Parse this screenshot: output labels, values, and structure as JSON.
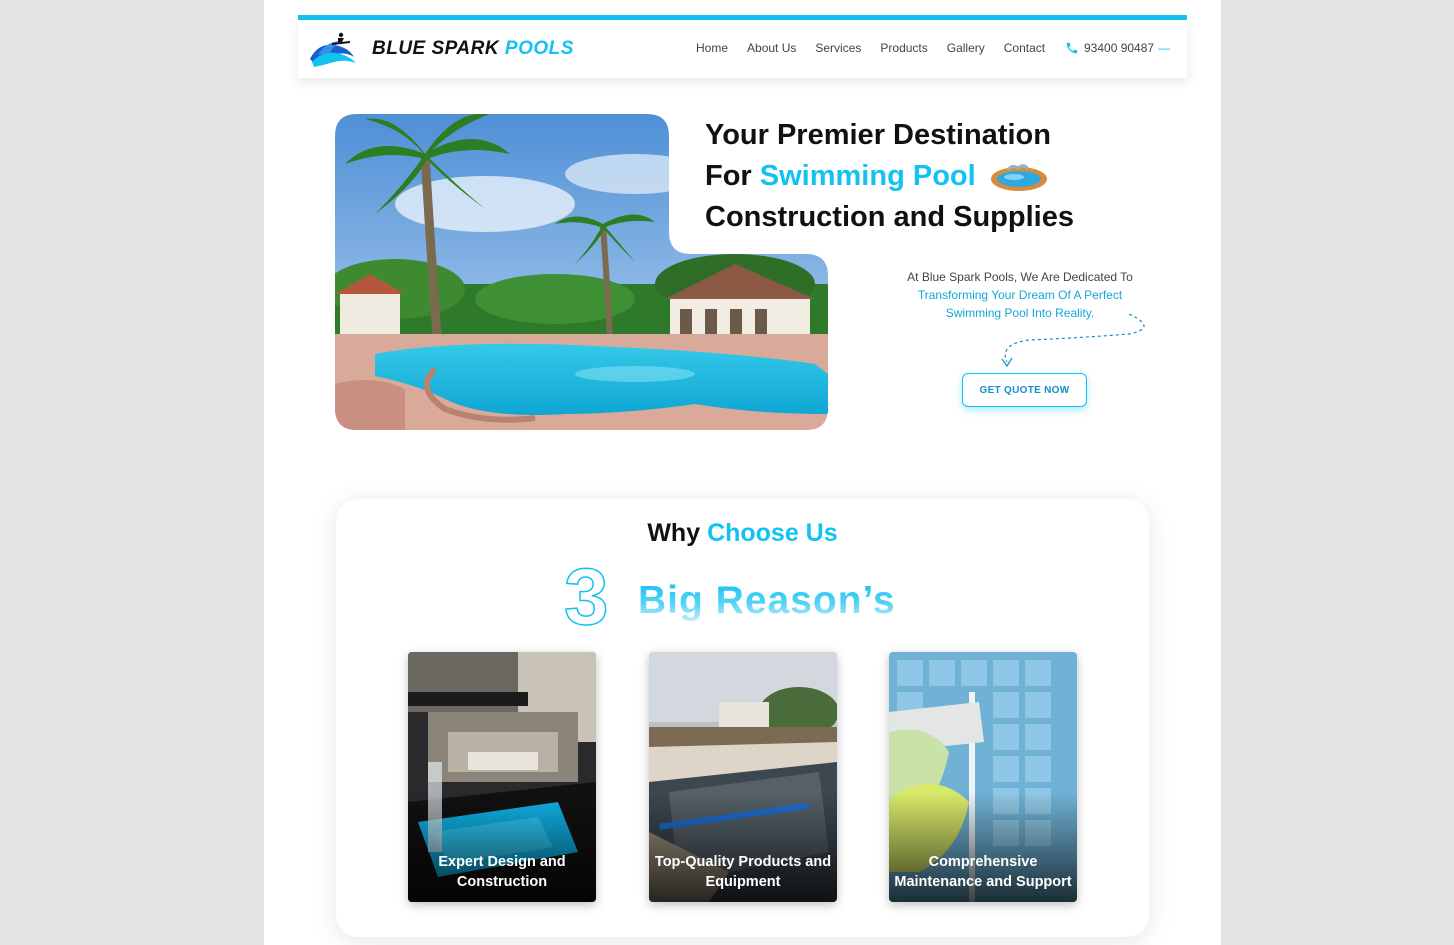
{
  "header": {
    "brand_part1": "BLUE SPARK",
    "brand_part2": "POOLS",
    "nav": [
      "Home",
      "About Us",
      "Services",
      "Products",
      "Gallery",
      "Contact"
    ],
    "phone": "93400 90487",
    "phone_suffix": "—"
  },
  "hero": {
    "title_line1": "Your Premier Destination",
    "title_for": "For",
    "title_highlight": "Swimming Pool",
    "title_line3": "Construction and Supplies",
    "desc_plain": "At Blue Spark Pools, We Are Dedicated To",
    "desc_highlight": "Transforming Your Dream Of A Perfect Swimming Pool Into Reality.",
    "cta": "GET QUOTE NOW"
  },
  "why": {
    "title_plain": "Why",
    "title_highlight": "Choose Us",
    "number": "3",
    "reasons_label": "Big Reason’s",
    "reasons": [
      "Expert Design and Construction",
      "Top-Quality Products and Equipment",
      "Comprehensive Maintenance and Support"
    ]
  },
  "colors": {
    "accent": "#12c3f2",
    "text": "#111111",
    "page_bg": "#e4e4e4"
  }
}
